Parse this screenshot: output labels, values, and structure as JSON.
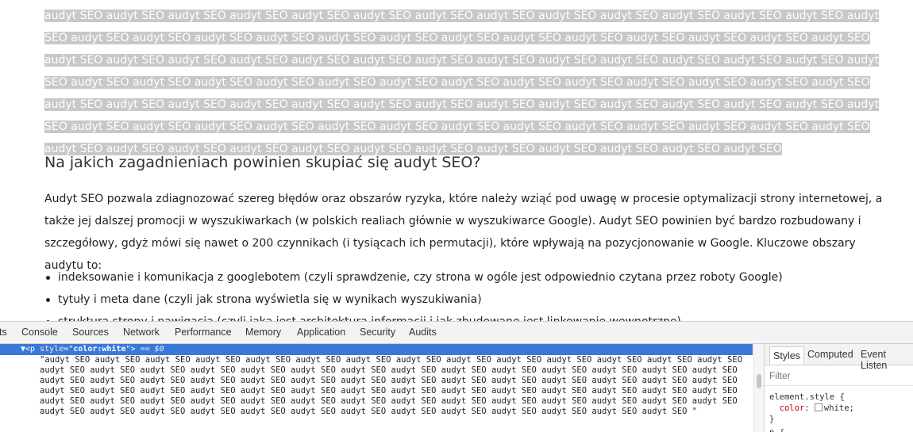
{
  "page": {
    "hidden_text": "audyt SEO audyt SEO audyt SEO audyt SEO audyt SEO audyt SEO audyt SEO audyt SEO audyt SEO audyt SEO audyt SEO audyt SEO audyt SEO audyt SEO audyt SEO audyt SEO audyt SEO audyt SEO audyt SEO audyt SEO audyt SEO audyt SEO audyt SEO audyt SEO audyt SEO audyt SEO audyt SEO audyt SEO audyt SEO audyt SEO audyt SEO audyt SEO audyt SEO audyt SEO audyt SEO audyt SEO audyt SEO audyt SEO audyt SEO audyt SEO audyt SEO audyt SEO audyt SEO audyt SEO audyt SEO audyt SEO audyt SEO audyt SEO audyt SEO audyt SEO audyt SEO audyt SEO audyt SEO audyt SEO audyt SEO audyt SEO audyt SEO audyt SEO audyt SEO audyt SEO audyt SEO audyt SEO audyt SEO audyt SEO audyt SEO audyt SEO audyt SEO audyt SEO audyt SEO audyt SEO audyt SEO audyt SEO audyt SEO audyt SEO audyt SEO audyt SEO audyt SEO audyt SEO audyt SEO audyt SEO audyt SEO audyt SEO audyt SEO audyt SEO audyt SEO audyt SEO audyt SEO audyt SEO audyt SEO audyt SEO audyt SEO audyt SEO audyt SEO",
    "heading": "Na jakich zagadnieniach powinien skupiać się audyt SEO?",
    "paragraph": "Audyt SEO pozwala zdiagnozować szereg błędów oraz obszarów ryzyka, które należy wziąć pod uwagę w procesie optymalizacji strony internetowej, a także jej dalszej promocji w wyszukiwarkach (w polskich realiach głównie w wyszukiwarce Google). Audyt SEO powinien być bardzo rozbudowany i szczegółowy, gdyż mówi się nawet o 200 czynnikach (i tysiącach ich permutacji), które wpływają na pozycjonowanie w Google. Kluczowe obszary audytu to:",
    "list": [
      "indeksowanie i komunikacja z googlebotem (czyli sprawdzenie, czy strona w ogóle jest odpowiednio czytana przez roboty Google)",
      "tytuły i meta dane (czyli jak strona wyświetla się w wynikach wyszukiwania)",
      "struktura strony i nawigacja (czyli jaka jest architektura informacji i jak zbudowane jest linkowanie wewnętrzne)"
    ]
  },
  "devtools": {
    "tabs": [
      "ts",
      "Console",
      "Sources",
      "Network",
      "Performance",
      "Memory",
      "Application",
      "Security",
      "Audits"
    ],
    "selected_node": {
      "arrow": "▼",
      "tag_open": "<p",
      "attr_name": "style",
      "attr_value": "color:white",
      "tag_close": ">",
      "eq": "== $0"
    },
    "text_node": "\"audyt SEO audyt SEO audyt SEO audyt SEO audyt SEO audyt SEO audyt SEO audyt SEO audyt SEO audyt SEO audyt SEO audyt SEO audyt SEO audyt SEO audyt SEO audyt SEO audyt SEO audyt SEO audyt SEO audyt SEO audyt SEO audyt SEO audyt SEO audyt SEO audyt SEO audyt SEO audyt SEO audyt SEO audyt SEO audyt SEO audyt SEO audyt SEO audyt SEO audyt SEO audyt SEO audyt SEO audyt SEO audyt SEO audyt SEO audyt SEO audyt SEO audyt SEO audyt SEO audyt SEO audyt SEO audyt SEO audyt SEO audyt SEO audyt SEO audyt SEO audyt SEO audyt SEO audyt SEO audyt SEO audyt SEO audyt SEO audyt SEO audyt SEO audyt SEO audyt SEO audyt SEO audyt SEO audyt SEO audyt SEO audyt SEO audyt SEO audyt SEO audyt SEO audyt SEO audyt SEO audyt SEO audyt SEO audyt SEO audyt SEO audyt SEO audyt SEO audyt SEO audyt SEO audyt SEO audyt SEO audyt SEO audyt SEO audyt SEO \"",
    "styles": {
      "tabs": [
        "Styles",
        "Computed",
        "Event Listen"
      ],
      "filter_placeholder": "Filter",
      "rule_selector": "element.style {",
      "rule_prop": "color",
      "rule_value": "white;",
      "rule_close": "}",
      "next_rule": "p {"
    },
    "colors": {
      "selection": "#3879d9",
      "hidden_highlight": "#c8c8c8"
    }
  }
}
